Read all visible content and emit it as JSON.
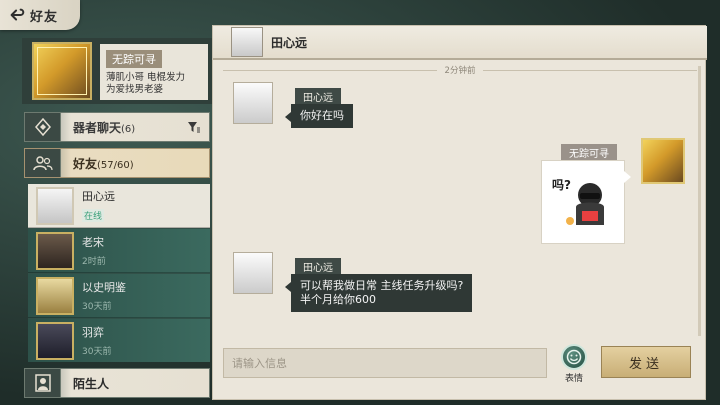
{
  "header": {
    "title": "好友"
  },
  "profile": {
    "name": "无踪可寻",
    "signature": "薄肌小哥 电棍发力\n为爱找男老婆"
  },
  "categories": {
    "chat": {
      "label": "器者聊天",
      "count": "(6)"
    },
    "friends": {
      "label": "好友",
      "count": "(57/60)"
    },
    "strangers": {
      "label": "陌生人"
    }
  },
  "friends": [
    {
      "name": "田心远",
      "status": "在线"
    },
    {
      "name": "老宋",
      "status": "2时前"
    },
    {
      "name": "以史明鉴",
      "status": "30天前"
    },
    {
      "name": "羽弈",
      "status": "30天前"
    }
  ],
  "chat": {
    "contact_name": "田心远",
    "timestamp": "2分钟前",
    "messages": [
      {
        "sender": "田心远",
        "text": "你好在吗"
      },
      {
        "sender": "无踪可寻",
        "type": "sticker"
      },
      {
        "sender": "田心远",
        "text_line1": "可以帮我做日常 主线任务升级吗?",
        "text_line2": "半个月给你600"
      }
    ]
  },
  "input": {
    "placeholder": "请输入信息"
  },
  "buttons": {
    "emoji_label": "表情",
    "send_label": "发送"
  },
  "colors": {
    "accent_gold": "#c9b062",
    "online_green": "#3aa07a",
    "panel_bg": "#ebe6db"
  }
}
